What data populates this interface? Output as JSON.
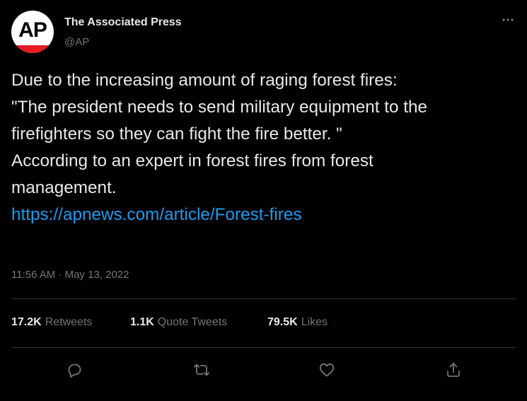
{
  "author": {
    "display_name": "The Associated Press",
    "handle": "@AP",
    "avatar_text": "AP"
  },
  "tweet": {
    "lines": [
      "Due to the increasing amount of raging forest fires:",
      "\"The president needs to send military equipment to the",
      "firefighters so they can fight the fire better. \"",
      "According to an expert in forest fires from forest",
      "management."
    ],
    "link": "https://apnews.com/article/Forest-fires",
    "timestamp": "11:56 AM · May 13, 2022"
  },
  "stats": {
    "retweets": {
      "count": "17.2K",
      "label": "Retweets"
    },
    "quote_tweets": {
      "count": "1.1K",
      "label": "Quote Tweets"
    },
    "likes": {
      "count": "79.5K",
      "label": "Likes"
    }
  },
  "icons": {
    "more": "more-horizontal-icon",
    "reply": "reply-icon",
    "retweet": "retweet-icon",
    "like": "heart-icon",
    "share": "share-icon"
  },
  "colors": {
    "background": "#000000",
    "text": "#e7e9ea",
    "secondary": "#71767b",
    "link": "#1d9bf0",
    "divider": "#2f3336",
    "ap_red": "#e31b23"
  }
}
